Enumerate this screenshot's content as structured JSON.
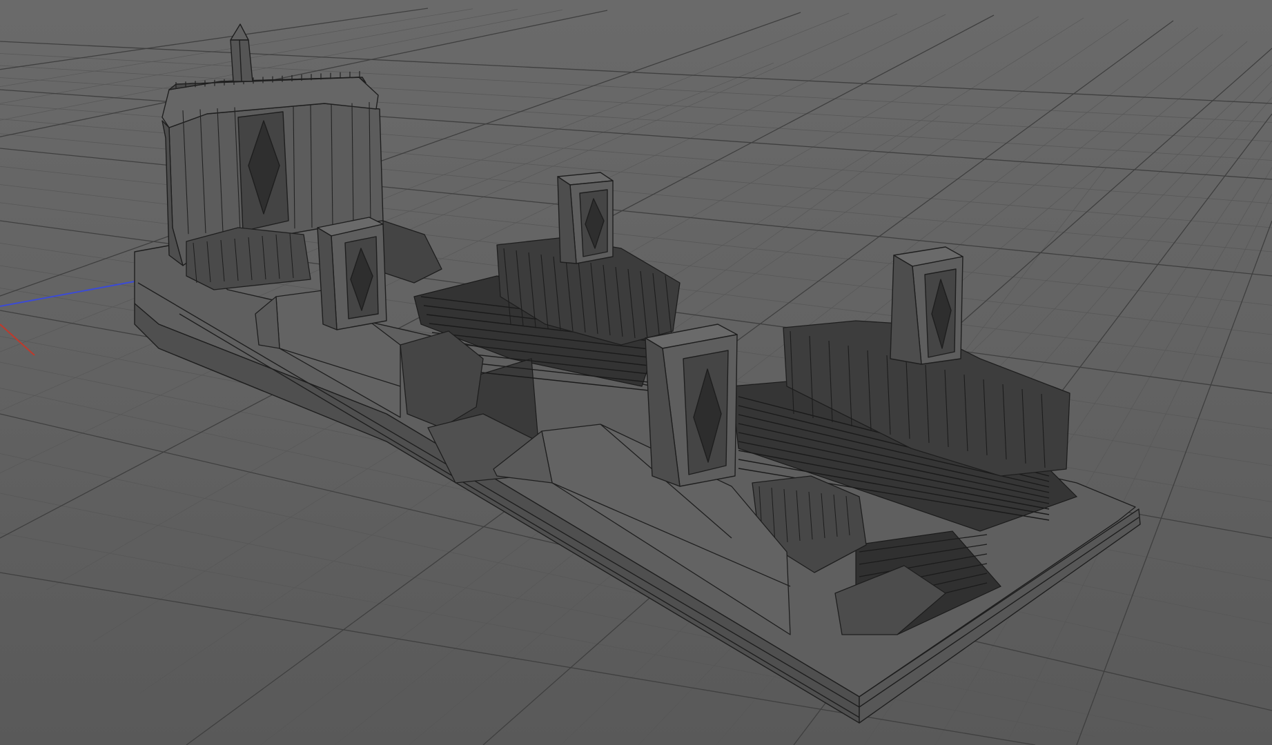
{
  "viewport": {
    "kind": "3d-perspective-viewport",
    "shading": "wireframe-on-shaded",
    "background_color": "#626262",
    "grid": true
  },
  "colors": {
    "grid_major": "#3f3f3f",
    "grid_minor": "#575757",
    "x_axis": "#c0392b",
    "z_axis": "#3b4bd6",
    "mesh_fill": "#5d5d5d",
    "mesh_face_light": "#686868",
    "mesh_face_dark": "#3a3a3a",
    "mesh_wire": "#1e1e1e"
  },
  "scene_objects": [
    {
      "name": "model-base-plinth"
    },
    {
      "name": "domed-tower-building"
    },
    {
      "name": "spire-ornament"
    },
    {
      "name": "pylon-1"
    },
    {
      "name": "pylon-2"
    },
    {
      "name": "pylon-3"
    },
    {
      "name": "pylon-4"
    },
    {
      "name": "rail-track-bays"
    }
  ]
}
